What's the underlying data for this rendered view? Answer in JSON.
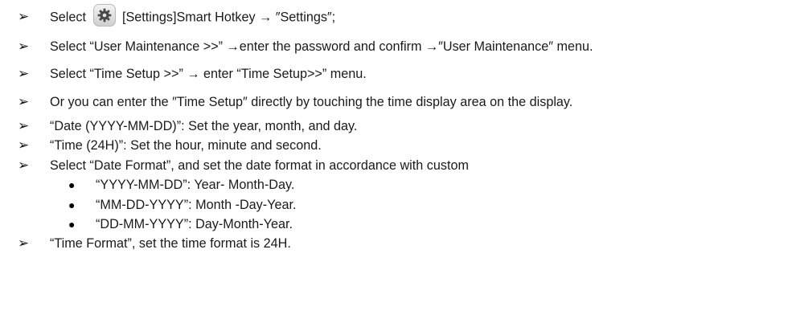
{
  "steps": [
    {
      "bullet": "➢",
      "before_icon": "Select",
      "icon": "gear-icon",
      "after_icon": "[Settings]Smart Hotkey → ″Settings″;"
    },
    {
      "bullet": "➢",
      "text": "Select “User Maintenance >>” →enter the password and confirm →″User Maintenance″ menu."
    },
    {
      "bullet": "➢",
      "text": "Select “Time Setup >>” → enter “Time Setup>>” menu."
    },
    {
      "bullet": "➢",
      "text": "Or you can enter the ″Time Setup″ directly by touching the time display area on the display."
    },
    {
      "bullet": "➢",
      "text": "“Date (YYYY-MM-DD)”: Set the year, month, and day."
    },
    {
      "bullet": "➢",
      "text": "“Time (24H)”: Set the hour, minute and second."
    },
    {
      "bullet": "➢",
      "text": "Select “Date Format”, and set the date format in accordance with custom"
    },
    {
      "bullet": "➢",
      "text": "“Time Format”, set the time format is 24H."
    }
  ],
  "sub_items": [
    {
      "bullet": "●",
      "text": "“YYYY-MM-DD”: Year- Month-Day."
    },
    {
      "bullet": "●",
      "text": "“MM-DD-YYYY”: Month -Day-Year."
    },
    {
      "bullet": "●",
      "text": "“DD-MM-YYYY”: Day-Month-Year."
    }
  ]
}
